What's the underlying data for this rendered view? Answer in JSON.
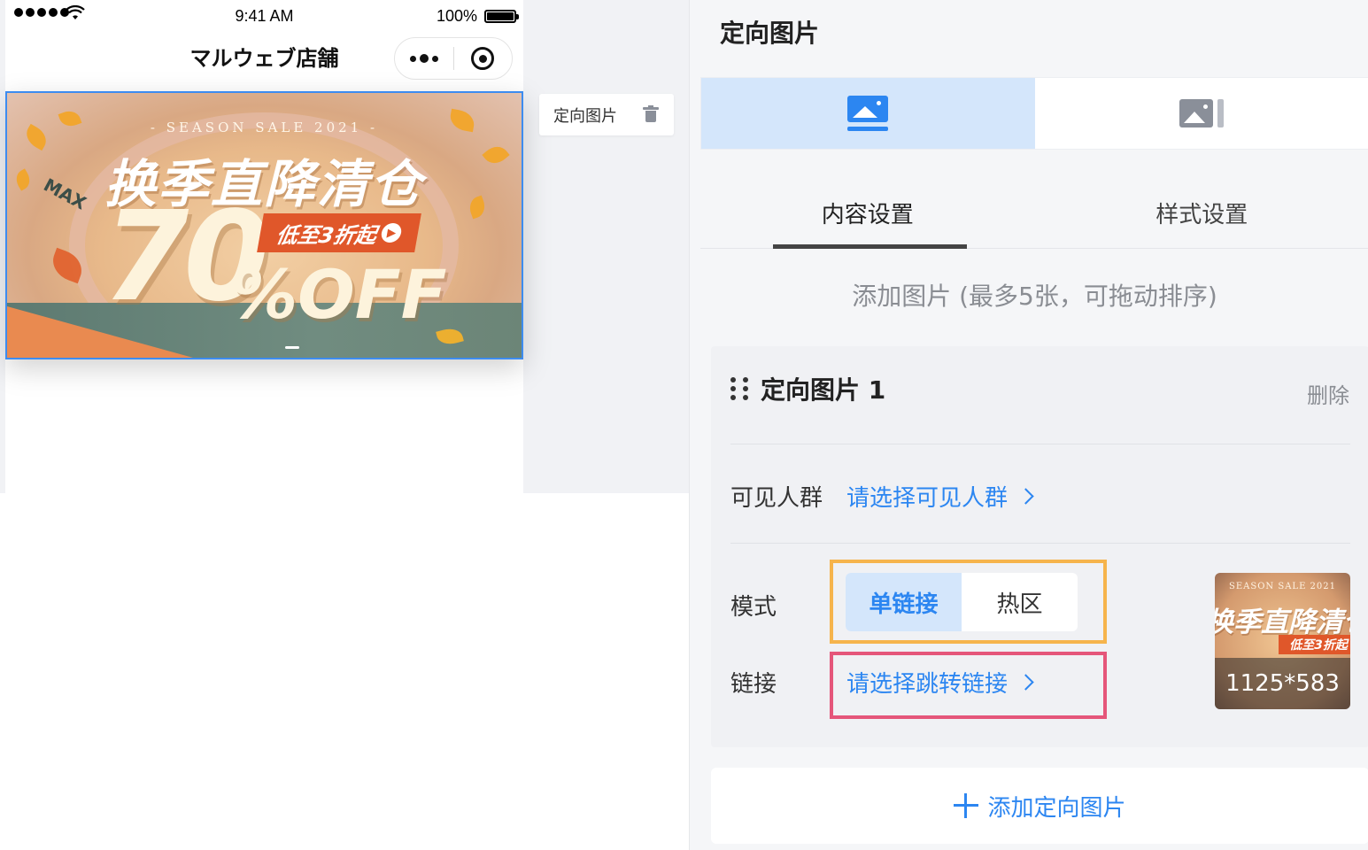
{
  "status_bar": {
    "time": "9:41 AM",
    "battery": "100%"
  },
  "mini_app": {
    "title": "マルウェブ店舗"
  },
  "banner": {
    "season": "- SEASON SALE 2021 -",
    "headline": "换季直降清仓",
    "max_label": "MAX",
    "discount": "70",
    "off": "%OFF",
    "promo": "低至3折起"
  },
  "component_tag": {
    "label": "定向图片"
  },
  "panel": {
    "title": "定向图片",
    "tabs": [
      "内容设置",
      "样式设置"
    ],
    "add_hint": "添加图片 (最多5张，可拖动排序)",
    "card": {
      "title": "定向图片 1",
      "delete": "删除",
      "audience_label": "可见人群",
      "audience_value": "请选择可见人群",
      "mode_label": "模式",
      "mode_options": [
        "单链接",
        "热区"
      ],
      "mode_selected": "单链接",
      "link_label": "链接",
      "link_value": "请选择跳转链接",
      "thumbnail_size": "1125*583",
      "thumbnail_headline": "换季直降清仓",
      "thumbnail_season": "SEASON SALE 2021",
      "thumbnail_promo": "低至3折起"
    },
    "add_button": "添加定向图片"
  },
  "colors": {
    "accent": "#2c86f1",
    "accent_light": "#d4e6fb",
    "highlight_orange": "#f6b44c",
    "highlight_pink": "#e5567a",
    "selection_border": "#3d8cf0"
  },
  "icons": [
    "wifi-icon",
    "battery-icon",
    "more-icon",
    "close-circle-icon",
    "trash-icon",
    "image-single-icon",
    "image-carousel-icon",
    "drag-handle-icon",
    "chevron-right-icon",
    "plus-icon"
  ]
}
